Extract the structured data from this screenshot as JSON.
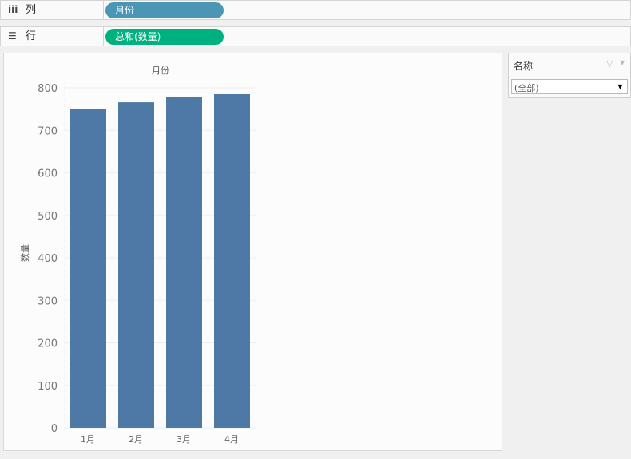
{
  "shelves": {
    "columns": {
      "label": "列",
      "icon": "columns-icon",
      "pill": "月份",
      "pill_color": "#4a96b4"
    },
    "rows": {
      "label": "行",
      "icon": "rows-icon",
      "pill": "总和(数量)",
      "pill_color": "#00b180"
    }
  },
  "filter": {
    "title": "名称",
    "value": "(全部)"
  },
  "chart_data": {
    "type": "bar",
    "title": "月份",
    "xlabel": "",
    "ylabel": "数量",
    "categories": [
      "1月",
      "2月",
      "3月",
      "4月"
    ],
    "values": [
      751,
      766,
      779,
      785
    ],
    "ylim": [
      0,
      800
    ],
    "yticks": [
      0,
      100,
      200,
      300,
      400,
      500,
      600,
      700,
      800
    ],
    "grid": true,
    "bar_color": "#4e79a7"
  }
}
